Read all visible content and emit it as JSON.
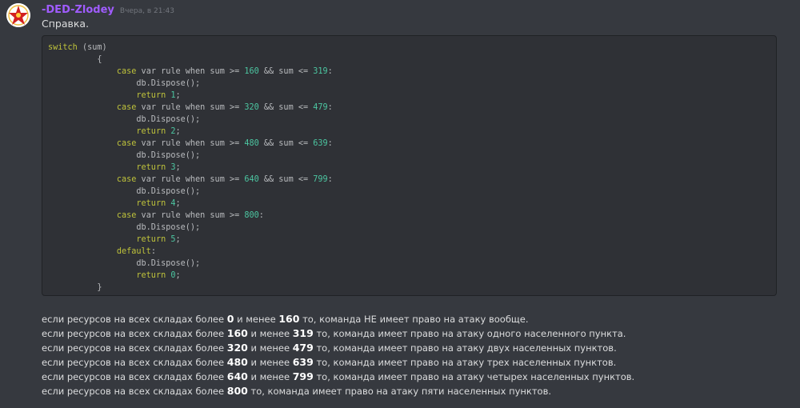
{
  "message": {
    "author": "-DED-Zlodey",
    "timestamp": "Вчера, в 21:43",
    "title": "Справка."
  },
  "code": {
    "lines": [
      [
        {
          "t": "switch",
          "c": "kw"
        },
        {
          "t": " (sum)",
          "c": "txt"
        }
      ],
      [
        {
          "t": "          {",
          "c": "txt"
        }
      ],
      [
        {
          "t": "              ",
          "c": "txt"
        },
        {
          "t": "case",
          "c": "kw"
        },
        {
          "t": " var rule when sum >= ",
          "c": "txt"
        },
        {
          "t": "160",
          "c": "num"
        },
        {
          "t": " && sum <= ",
          "c": "txt"
        },
        {
          "t": "319",
          "c": "num"
        },
        {
          "t": ":",
          "c": "txt"
        }
      ],
      [
        {
          "t": "                  db.Dispose();",
          "c": "txt"
        }
      ],
      [
        {
          "t": "                  ",
          "c": "txt"
        },
        {
          "t": "return",
          "c": "kw"
        },
        {
          "t": " ",
          "c": "txt"
        },
        {
          "t": "1",
          "c": "num"
        },
        {
          "t": ";",
          "c": "txt"
        }
      ],
      [
        {
          "t": "              ",
          "c": "txt"
        },
        {
          "t": "case",
          "c": "kw"
        },
        {
          "t": " var rule when sum >= ",
          "c": "txt"
        },
        {
          "t": "320",
          "c": "num"
        },
        {
          "t": " && sum <= ",
          "c": "txt"
        },
        {
          "t": "479",
          "c": "num"
        },
        {
          "t": ":",
          "c": "txt"
        }
      ],
      [
        {
          "t": "                  db.Dispose();",
          "c": "txt"
        }
      ],
      [
        {
          "t": "                  ",
          "c": "txt"
        },
        {
          "t": "return",
          "c": "kw"
        },
        {
          "t": " ",
          "c": "txt"
        },
        {
          "t": "2",
          "c": "num"
        },
        {
          "t": ";",
          "c": "txt"
        }
      ],
      [
        {
          "t": "              ",
          "c": "txt"
        },
        {
          "t": "case",
          "c": "kw"
        },
        {
          "t": " var rule when sum >= ",
          "c": "txt"
        },
        {
          "t": "480",
          "c": "num"
        },
        {
          "t": " && sum <= ",
          "c": "txt"
        },
        {
          "t": "639",
          "c": "num"
        },
        {
          "t": ":",
          "c": "txt"
        }
      ],
      [
        {
          "t": "                  db.Dispose();",
          "c": "txt"
        }
      ],
      [
        {
          "t": "                  ",
          "c": "txt"
        },
        {
          "t": "return",
          "c": "kw"
        },
        {
          "t": " ",
          "c": "txt"
        },
        {
          "t": "3",
          "c": "num"
        },
        {
          "t": ";",
          "c": "txt"
        }
      ],
      [
        {
          "t": "              ",
          "c": "txt"
        },
        {
          "t": "case",
          "c": "kw"
        },
        {
          "t": " var rule when sum >= ",
          "c": "txt"
        },
        {
          "t": "640",
          "c": "num"
        },
        {
          "t": " && sum <= ",
          "c": "txt"
        },
        {
          "t": "799",
          "c": "num"
        },
        {
          "t": ":",
          "c": "txt"
        }
      ],
      [
        {
          "t": "                  db.Dispose();",
          "c": "txt"
        }
      ],
      [
        {
          "t": "                  ",
          "c": "txt"
        },
        {
          "t": "return",
          "c": "kw"
        },
        {
          "t": " ",
          "c": "txt"
        },
        {
          "t": "4",
          "c": "num"
        },
        {
          "t": ";",
          "c": "txt"
        }
      ],
      [
        {
          "t": "              ",
          "c": "txt"
        },
        {
          "t": "case",
          "c": "kw"
        },
        {
          "t": " var rule when sum >= ",
          "c": "txt"
        },
        {
          "t": "800",
          "c": "num"
        },
        {
          "t": ":",
          "c": "txt"
        }
      ],
      [
        {
          "t": "                  db.Dispose();",
          "c": "txt"
        }
      ],
      [
        {
          "t": "                  ",
          "c": "txt"
        },
        {
          "t": "return",
          "c": "kw"
        },
        {
          "t": " ",
          "c": "txt"
        },
        {
          "t": "5",
          "c": "num"
        },
        {
          "t": ";",
          "c": "txt"
        }
      ],
      [
        {
          "t": "              ",
          "c": "txt"
        },
        {
          "t": "default",
          "c": "kw"
        },
        {
          "t": ":",
          "c": "txt"
        }
      ],
      [
        {
          "t": "                  db.Dispose();",
          "c": "txt"
        }
      ],
      [
        {
          "t": "                  ",
          "c": "txt"
        },
        {
          "t": "return",
          "c": "kw"
        },
        {
          "t": " ",
          "c": "txt"
        },
        {
          "t": "0",
          "c": "num"
        },
        {
          "t": ";",
          "c": "txt"
        }
      ],
      [
        {
          "t": "          }",
          "c": "txt"
        }
      ]
    ]
  },
  "description": {
    "lines": [
      [
        {
          "t": "если ресурсов на всех складах более ",
          "b": false
        },
        {
          "t": "0",
          "b": true
        },
        {
          "t": " и менее ",
          "b": false
        },
        {
          "t": "160",
          "b": true
        },
        {
          "t": " то, команда НЕ имеет право на атаку вообще.",
          "b": false
        }
      ],
      [
        {
          "t": "если ресурсов на всех складах более ",
          "b": false
        },
        {
          "t": "160",
          "b": true
        },
        {
          "t": " и менее ",
          "b": false
        },
        {
          "t": "319",
          "b": true
        },
        {
          "t": " то, команда имеет право на атаку одного населенного пункта.",
          "b": false
        }
      ],
      [
        {
          "t": "если ресурсов на всех складах более ",
          "b": false
        },
        {
          "t": "320",
          "b": true
        },
        {
          "t": " и менее ",
          "b": false
        },
        {
          "t": "479",
          "b": true
        },
        {
          "t": " то, команда имеет право на атаку двух населенных пунктов.",
          "b": false
        }
      ],
      [
        {
          "t": "если ресурсов на всех складах более ",
          "b": false
        },
        {
          "t": "480",
          "b": true
        },
        {
          "t": " и менее ",
          "b": false
        },
        {
          "t": "639",
          "b": true
        },
        {
          "t": " то, команда имеет право на атаку трех населенных пунктов.",
          "b": false
        }
      ],
      [
        {
          "t": "если ресурсов на всех складах более ",
          "b": false
        },
        {
          "t": "640",
          "b": true
        },
        {
          "t": " и менее ",
          "b": false
        },
        {
          "t": "799",
          "b": true
        },
        {
          "t": " то, команда имеет право на атаку четырех населенных пунктов.",
          "b": false
        }
      ],
      [
        {
          "t": "если ресурсов на всех складах более ",
          "b": false
        },
        {
          "t": "800",
          "b": true
        },
        {
          "t": "  то, команда имеет право на атаку пяти населенных пунктов.",
          "b": false
        }
      ]
    ]
  },
  "colors": {
    "background": "#36393f",
    "code_background": "#2f3136",
    "username": "#a05cff",
    "keyword": "#bfc33b",
    "number": "#4cc6a1"
  },
  "icons": {
    "avatar": "red-star-avatar-icon"
  }
}
